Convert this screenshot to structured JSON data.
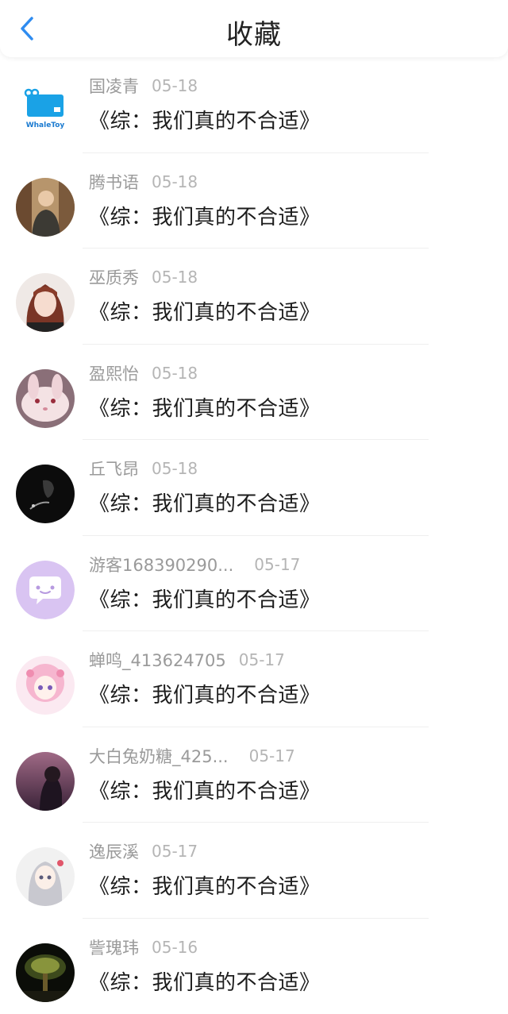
{
  "header": {
    "title": "收藏",
    "back_icon": "chevron-left-icon",
    "accent": "#2f8cf0"
  },
  "items": [
    {
      "user": "国凌青",
      "date": "05-18",
      "title": "《综：我们真的不合适》",
      "avatar": "whaletoy-logo",
      "avatar_text": "WhaleToy"
    },
    {
      "user": "腾书语",
      "date": "05-18",
      "title": "《综：我们真的不合适》",
      "avatar": "photo-man-portrait"
    },
    {
      "user": "巫质秀",
      "date": "05-18",
      "title": "《综：我们真的不合适》",
      "avatar": "photo-girl-portrait"
    },
    {
      "user": "盈熙怡",
      "date": "05-18",
      "title": "《综：我们真的不合适》",
      "avatar": "photo-rabbit"
    },
    {
      "user": "丘飞昂",
      "date": "05-18",
      "title": "《综：我们真的不合适》",
      "avatar": "photo-dark"
    },
    {
      "user": "游客168390290...",
      "date": "05-17",
      "title": "《综：我们真的不合适》",
      "avatar": "default-chat-bubble-avatar"
    },
    {
      "user": "蝉鸣_413624705",
      "date": "05-17",
      "title": "《综：我们真的不合适》",
      "avatar": "anime-pink-hair"
    },
    {
      "user": "大白兔奶糖_425...",
      "date": "05-17",
      "title": "《综：我们真的不合适》",
      "avatar": "photo-dusk-girl"
    },
    {
      "user": "逸辰溪",
      "date": "05-17",
      "title": "《综：我们真的不合适》",
      "avatar": "anime-girl"
    },
    {
      "user": "訾瑰玮",
      "date": "05-16",
      "title": "《综：我们真的不合适》",
      "avatar": "photo-glowing-tree"
    }
  ]
}
